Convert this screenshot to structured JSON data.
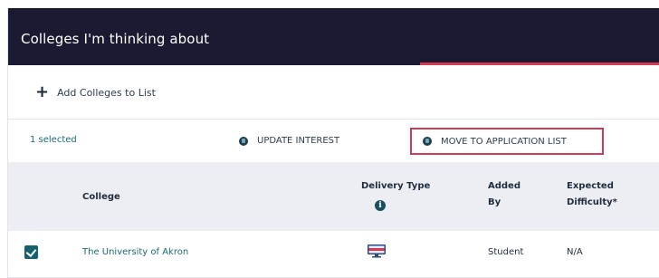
{
  "header": {
    "title": "Colleges I'm thinking about"
  },
  "actions": {
    "add_label": "Add Colleges to List"
  },
  "toolbar": {
    "selected_text": "1 selected",
    "update_label": "UPDATE INTEREST",
    "move_label": "MOVE TO APPLICATION LIST",
    "highlight_color": "#cf3c55"
  },
  "table": {
    "columns": {
      "college": "College",
      "delivery_type": "Delivery Type",
      "added_by": "Added By",
      "expected_difficulty": "Expected Difficulty*"
    },
    "rows": [
      {
        "checked": true,
        "college": "The University of Akron",
        "delivery_icon": "computer-monitor-icon",
        "added_by": "Student",
        "expected_difficulty": "N/A"
      }
    ]
  },
  "colors": {
    "header_bg": "#1b1a33",
    "accent": "#d83a52",
    "link": "#1a6a7a",
    "checkbox": "#15616e"
  }
}
